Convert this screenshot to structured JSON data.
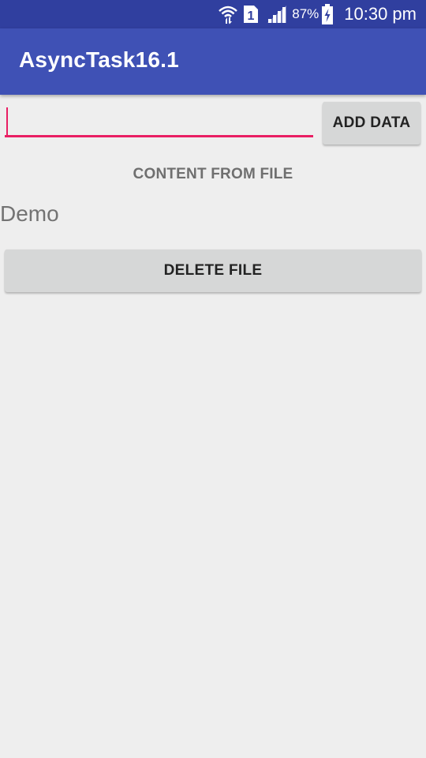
{
  "status_bar": {
    "battery_percent": "87%",
    "time": "10:30 pm",
    "sim_slot": "1",
    "icons": [
      "wifi-icon",
      "sim-icon",
      "signal-icon",
      "battery-charging-icon"
    ],
    "background_color": "#303f9f"
  },
  "app_bar": {
    "title": "AsyncTask16.1",
    "background_color": "#3f51b5"
  },
  "input": {
    "value": "",
    "placeholder": "",
    "accent_color": "#e91e63"
  },
  "buttons": {
    "add_data_label": "ADD DATA",
    "delete_file_label": "DELETE FILE"
  },
  "content": {
    "header": "CONTENT FROM FILE",
    "text": "Demo"
  }
}
